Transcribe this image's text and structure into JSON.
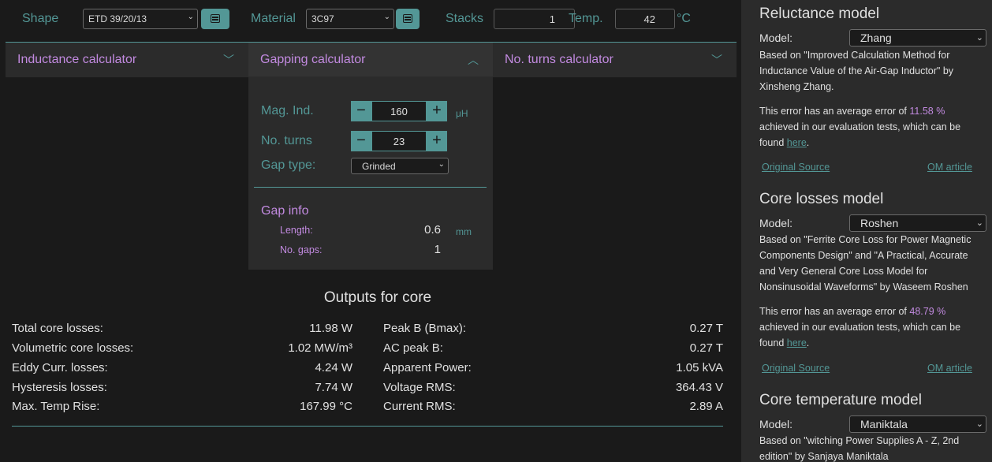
{
  "topbar": {
    "shape_label": "Shape",
    "shape_value": "ETD 39/20/13",
    "material_label": "Material",
    "material_value": "3C97",
    "stacks_label": "Stacks",
    "stacks_value": "1",
    "temp_label": "Temp.",
    "temp_value": "42",
    "temp_unit": "°C"
  },
  "accordion": {
    "tabs": [
      {
        "label": "Inductance calculator"
      },
      {
        "label": "Gapping calculator"
      },
      {
        "label": "No. turns calculator"
      }
    ]
  },
  "gapping": {
    "mag_ind_label": "Mag. Ind.",
    "mag_ind_value": "160",
    "mag_ind_unit": "μH",
    "turns_label": "No. turns",
    "turns_value": "23",
    "gap_type_label": "Gap type:",
    "gap_type_value": "Grinded",
    "gap_info_title": "Gap info",
    "length_label": "Length:",
    "length_value": "0.6",
    "length_unit": "mm",
    "gaps_label": "No. gaps:",
    "gaps_value": "1"
  },
  "outputs": {
    "title": "Outputs for core",
    "left": [
      {
        "label": "Total core losses:",
        "value": "11.98 W"
      },
      {
        "label": "Volumetric core losses:",
        "value": "1.02 MW/m³"
      },
      {
        "label": "Eddy Curr. losses:",
        "value": "4.24 W"
      },
      {
        "label": "Hysteresis losses:",
        "value": "7.74 W"
      },
      {
        "label": "Max. Temp Rise:",
        "value": "167.99 °C"
      }
    ],
    "right": [
      {
        "label": "Peak B (Bmax):",
        "value": "0.27 T"
      },
      {
        "label": "AC peak B:",
        "value": "0.27 T"
      },
      {
        "label": "Apparent Power:",
        "value": "1.05 kVA"
      },
      {
        "label": "Voltage RMS:",
        "value": "364.43 V"
      },
      {
        "label": "Current RMS:",
        "value": "2.89 A"
      }
    ]
  },
  "sidebar": {
    "reluctance": {
      "title": "Reluctance model",
      "model_label": "Model:",
      "model_value": "Zhang",
      "desc": "Based on \"Improved Calculation Method for Inductance Value of the Air-Gap Inductor\" by Xinsheng Zhang.",
      "error_prefix": "This error has an average error of ",
      "error_value": "11.58 %",
      "error_suffix": "achieved in our evaluation tests, which can be found ",
      "here": "here",
      "dot": ".",
      "source_link": "Original Source",
      "article_link": "OM article"
    },
    "core_losses": {
      "title": "Core losses model",
      "model_label": "Model:",
      "model_value": "Roshen",
      "desc": "Based on \"Ferrite Core Loss for Power Magnetic Components Design\" and \"A Practical, Accurate and Very General Core Loss Model for Nonsinusoidal Waveforms\" by Waseem Roshen",
      "error_prefix": "This error has an average error of ",
      "error_value": "48.79 %",
      "error_suffix": "achieved in our evaluation tests, which can be found ",
      "here": "here",
      "dot": ".",
      "source_link": "Original Source",
      "article_link": "OM article"
    },
    "core_temp": {
      "title": "Core temperature model",
      "model_label": "Model:",
      "model_value": "Maniktala",
      "desc": "Based on \"witching Power Supplies A - Z, 2nd edition\" by Sanjaya Maniktala"
    }
  },
  "colors": {
    "accent_teal": "#539796",
    "accent_purple": "#c28ae0",
    "background": "#1a1a1a",
    "panel": "#2b2b2b"
  }
}
